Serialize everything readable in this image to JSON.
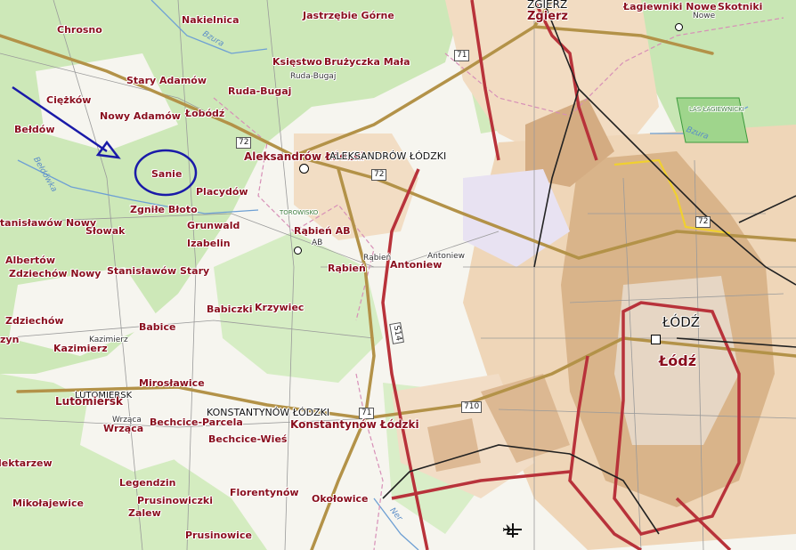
{
  "labels": {
    "nakielnica": "Nakielnica",
    "jastrzebie": "Jastrzębie Górne",
    "zgierz_head": "ZGIERZ",
    "zgierz": "Zgierz",
    "lagiewniki": "Łagiewniki Nowe",
    "skotniki": "Skotniki",
    "nowe": "Nowe",
    "chrosno": "Chrosno",
    "ksiestwo": "Księstwo",
    "bruzyczka": "Brużyczka Mała",
    "ruda_bugaj_small": "Ruda-Bugaj",
    "stary_adamow": "Stary Adamów",
    "ruda_bugaj": "Ruda-Bugaj",
    "ciezkow": "Ciężków",
    "nowy_adamow": "Nowy Adamów",
    "lobodz": "Łobódź",
    "beldow": "Bełdów",
    "aleksandrow": "Aleksandrów Łódzki",
    "aleksandrow_head": "ALEKSANDRÓW ŁÓDZKI",
    "sanie": "Sanie",
    "placydow": "Placydów",
    "zgnile_bloto": "Zgniłe Błoto",
    "stanislawow_nowy": "Stanisławów Nowy",
    "grunwald": "Grunwald",
    "slowak": "Słowak",
    "izabelin": "Izabelin",
    "rabien_ab": "Rąbień AB",
    "ab_small": "AB",
    "rabien_small": "Rąbień",
    "rabien": "Rąbień",
    "antoniew_small": "Antoniew",
    "antoniew": "Antoniew",
    "albertow": "Albertów",
    "zdziechow_nowy": "Zdziechów Nowy",
    "stanislawow_stary": "Stanisławów Stary",
    "babiczki": "Babiczki",
    "krzywiec": "Krzywiec",
    "zdziechow": "Zdziechów",
    "babice": "Babice",
    "zyn": "zyn",
    "kazimierz_small": "Kazimierz",
    "kazimierz": "Kazimierz",
    "lodz_head": "ŁÓDŹ",
    "lodz": "Łódź",
    "miroslawice": "Mirosławice",
    "lutomiersk_head": "LUTOMIERSK",
    "lutomiersk": "Lutomiersk",
    "konst_head": "KONSTANTYNÓW ŁÓDZKI",
    "konst": "Konstantynów Łódzki",
    "wrzaca_small": "Wrząca",
    "wrzaca": "Wrząca",
    "bechcice_parcela": "Bechcice-Parcela",
    "bechcice_wies": "Bechcice-Wieś",
    "lektarzew": "lektarzew",
    "legendzin": "Legendzin",
    "florentynow": "Florentynów",
    "okolowice": "Okołowice",
    "mikolajewice": "Mikołajewice",
    "prusinowiczki": "Prusinowiczki",
    "zalew": "Zalew",
    "prusinowice": "Prusinowice",
    "torowisko": "TOROWISKO",
    "lagiewniki_park": "LAS ŁAGIEWNICKI"
  },
  "rivers": {
    "bzura1": "Bzura",
    "bzura2": "Bzura",
    "belchowka": "Bełdówka",
    "ner": "Ner"
  },
  "road_numbers": {
    "r71_top": "71",
    "r72_a": "72",
    "r72_b": "72",
    "r72_c": "72",
    "s14": "S14",
    "r710": "710",
    "r71_bottom": "71"
  },
  "annotations": {
    "arrow_color": "#1a1aa8",
    "circle_color": "#1a1aa8",
    "highlight_target": "Sanie"
  },
  "colors": {
    "forest": "#c8e6b4",
    "urban": "#d9b48a",
    "road_main": "#b39248",
    "road_red": "#b8323a",
    "rail": "#222222",
    "water": "#6ea0d4"
  }
}
